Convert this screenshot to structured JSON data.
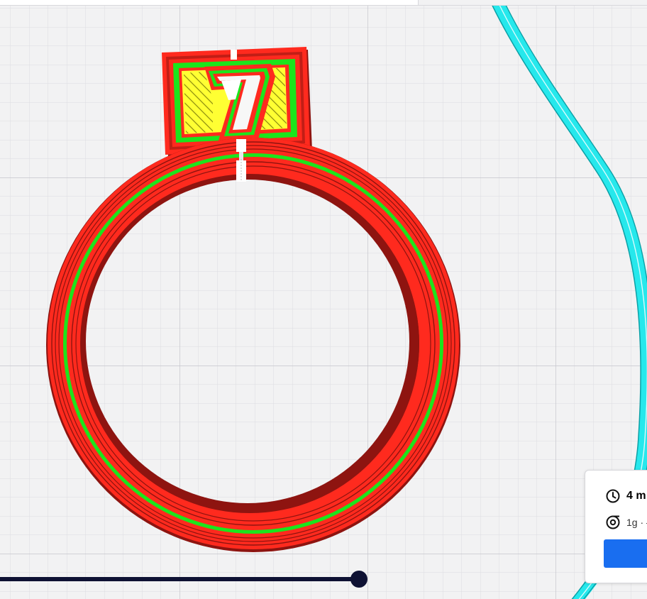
{
  "viewport": {
    "background": "#f2f2f3",
    "grid_minor_color": "#dcdce0",
    "grid_major_color": "#c6c6cc"
  },
  "model": {
    "layer_digit": "7",
    "colors": {
      "outer_wall": "#ff2a1e",
      "outer_wall_shadow": "#8e1410",
      "inner_wall": "#1ce51c",
      "infill": "#ffff33",
      "travel": "#26e8ec",
      "seam": "#ffffff"
    }
  },
  "layer_slider": {
    "color": "#0e1133"
  },
  "print_info": {
    "time_icon": "clock-icon",
    "time_text": "4 m",
    "material_icon": "spool-icon",
    "material_text": "1g · —",
    "button_color": "#196ef0"
  }
}
